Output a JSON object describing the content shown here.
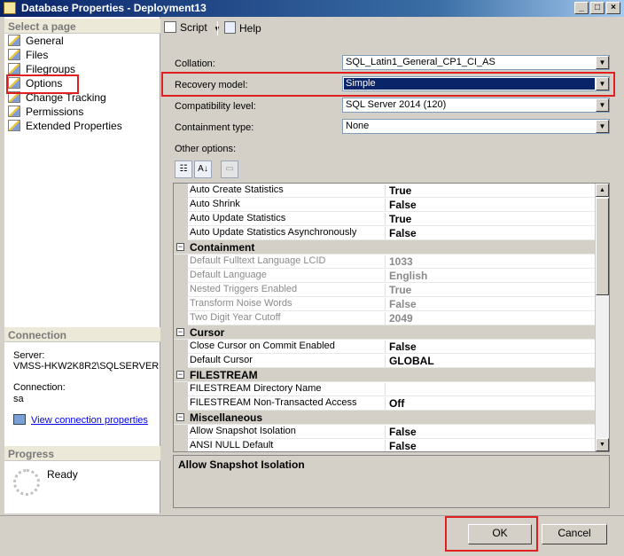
{
  "window": {
    "title": "Database Properties - Deployment13",
    "controls": [
      "_",
      "□",
      "×"
    ]
  },
  "left": {
    "select_page_header": "Select a page",
    "pages": [
      {
        "label": "General",
        "icon": "page-icon"
      },
      {
        "label": "Files",
        "icon": "page-icon"
      },
      {
        "label": "Filegroups",
        "icon": "page-icon"
      },
      {
        "label": "Options",
        "icon": "page-icon"
      },
      {
        "label": "Change Tracking",
        "icon": "page-icon"
      },
      {
        "label": "Permissions",
        "icon": "page-icon"
      },
      {
        "label": "Extended Properties",
        "icon": "page-icon"
      }
    ],
    "connection_header": "Connection",
    "server_label": "Server:",
    "server_value": "VMSS-HKW2K8R2\\SQLSERVER",
    "connection_label": "Connection:",
    "connection_value": "sa",
    "view_link": "View connection properties",
    "progress_header": "Progress",
    "progress_status": "Ready"
  },
  "toolbar": {
    "script_label": "Script",
    "help_label": "Help"
  },
  "options": {
    "collation_label": "Collation:",
    "collation_value": "SQL_Latin1_General_CP1_CI_AS",
    "recovery_label": "Recovery model:",
    "recovery_value": "Simple",
    "compat_label": "Compatibility level:",
    "compat_value": "SQL Server 2014 (120)",
    "containment_label": "Containment type:",
    "containment_value": "None",
    "other_label": "Other options:"
  },
  "grid": {
    "rows": [
      {
        "name": "Auto Create Statistics",
        "value": "True"
      },
      {
        "name": "Auto Shrink",
        "value": "False"
      },
      {
        "name": "Auto Update Statistics",
        "value": "True"
      },
      {
        "name": "Auto Update Statistics Asynchronously",
        "value": "False"
      },
      {
        "name": "Containment",
        "value": "",
        "category": true
      },
      {
        "name": "Default Fulltext Language LCID",
        "value": "1033",
        "disabled": true
      },
      {
        "name": "Default Language",
        "value": "English",
        "disabled": true
      },
      {
        "name": "Nested Triggers Enabled",
        "value": "True",
        "disabled": true
      },
      {
        "name": "Transform Noise Words",
        "value": "False",
        "disabled": true
      },
      {
        "name": "Two Digit Year Cutoff",
        "value": "2049",
        "disabled": true
      },
      {
        "name": "Cursor",
        "value": "",
        "category": true
      },
      {
        "name": "Close Cursor on Commit Enabled",
        "value": "False"
      },
      {
        "name": "Default Cursor",
        "value": "GLOBAL"
      },
      {
        "name": "FILESTREAM",
        "value": "",
        "category": true
      },
      {
        "name": "FILESTREAM Directory Name",
        "value": ""
      },
      {
        "name": "FILESTREAM Non-Transacted Access",
        "value": "Off"
      },
      {
        "name": "Miscellaneous",
        "value": "",
        "category": true
      },
      {
        "name": "Allow Snapshot Isolation",
        "value": "False"
      },
      {
        "name": "ANSI NULL Default",
        "value": "False"
      }
    ],
    "description_title": "Allow Snapshot Isolation"
  },
  "buttons": {
    "ok": "OK",
    "cancel": "Cancel"
  },
  "colors": {
    "highlight_box": "#e02020",
    "selection": "#0a246a"
  }
}
